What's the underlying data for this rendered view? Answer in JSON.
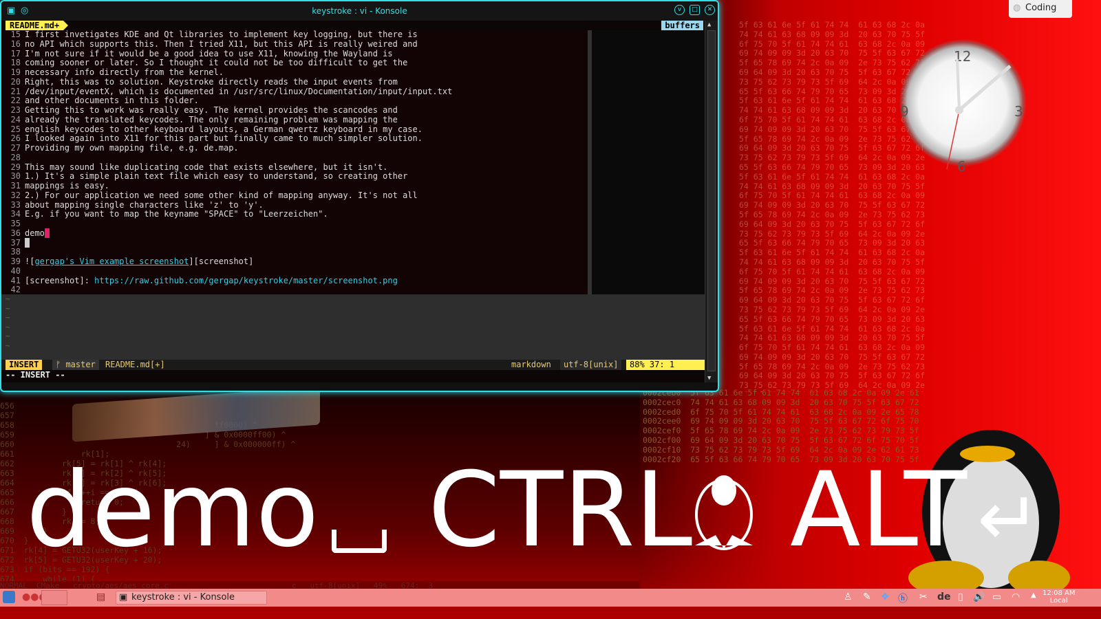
{
  "window": {
    "title": "keystroke : vi - Konsole"
  },
  "vim": {
    "tab": "README.md+",
    "buffers": "buffers",
    "lines": [
      {
        "n": "15",
        "t": "I first invetigates KDE and Qt libraries to implement key logging, but there is"
      },
      {
        "n": "16",
        "t": "no API which supports this. Then I tried X11, but this API is really weired and"
      },
      {
        "n": "17",
        "t": "I'm not sure if it would be a good idea to use X11, knowing the Wayland is"
      },
      {
        "n": "18",
        "t": "coming sooner or later. So I thought it could not be too difficult to get the"
      },
      {
        "n": "19",
        "t": "necessary info directly from the kernel."
      },
      {
        "n": "20",
        "t": "Right, this was to solution. Keystroke directly reads the input events from"
      },
      {
        "n": "21",
        "t": "/dev/input/eventX, which is documented in /usr/src/linux/Documentation/input/input.txt"
      },
      {
        "n": "22",
        "t": "and other documents in this folder."
      },
      {
        "n": "23",
        "t": "Getting this to work was really easy. The kernel provides the scancodes and"
      },
      {
        "n": "24",
        "t": "already the translated keycodes. The only remaining problem was mapping the"
      },
      {
        "n": "25",
        "t": "english keycodes to other keyboard layouts, a German qwertz keyboard in my case."
      },
      {
        "n": "26",
        "t": "I looked again into X11 for this part but finally came to much simpler solution."
      },
      {
        "n": "27",
        "t": "Providing my own mapping file, e.g. de.map."
      },
      {
        "n": "28",
        "t": ""
      },
      {
        "n": "29",
        "t": "This may sound like duplicating code that exists elsewhere, but it isn't."
      },
      {
        "n": "30",
        "t": "1.) It's a simple plain text file which easy to understand, so creating other"
      },
      {
        "n": "31",
        "t": "mappings is easy."
      },
      {
        "n": "32",
        "t": "2.) For our application we need some other kind of mapping anyway. It's not all"
      },
      {
        "n": "33",
        "t": "about mapping single characters like 'z' to 'y'."
      },
      {
        "n": "34",
        "t": "E.g. if you want to map the keyname \"SPACE\" to \"Leerzeichen\"."
      },
      {
        "n": "35",
        "t": ""
      },
      {
        "n": "36",
        "t": "demo"
      },
      {
        "n": "37",
        "t": ""
      },
      {
        "n": "38",
        "t": ""
      }
    ],
    "line39": {
      "n": "39",
      "pre": "![",
      "link": "gergap's Vim example screenshot",
      "post": "][screenshot]"
    },
    "line40": {
      "n": "40"
    },
    "line41": {
      "n": "41",
      "pre": "[screenshot]: ",
      "url": "https://raw.github.com/gergap/keystroke/master/screenshot.png"
    },
    "line42": {
      "n": "42"
    },
    "status": {
      "mode": "INSERT",
      "branch": "master",
      "file": "README.md[+]",
      "filetype": "markdown",
      "encoding": "utf-8[unix]",
      "percent": "88%",
      "position": "37:  1"
    },
    "cmdline": "-- INSERT --"
  },
  "background": {
    "code": [
      "656",
      "657",
      "658                                          ff0000) ^",
      "659                                        ] & 0x0000ff00) ^",
      "660                                  24)     ] & 0x000000ff) ^",
      "661              rk[1];",
      "662          rk[5] = rk[1] ^ rk[4];",
      "663          rk[6] = rk[2] ^ rk[5];",
      "664          rk[7] = rk[3] ^ rk[6];",
      "665          if (++i == 10) {",
      "666              return 0;",
      "667          }",
      "668          rk += 8;",
      "669      }",
      "670  }",
      "671  rk[4] = GETU32(userKey + 16);",
      "672  rk[5] = GETU32(userKey + 20);",
      "673  if (bits == 192) {",
      "674      while (1) {"
    ],
    "status": "NORMAL  CMake   crypto/aes/aes_core.c                           c   utf-8[unix]   49%   674:  3",
    "hex": [
      "0002ceb0  5f 63 61 6e 5f 61 74 74  61 63 68 2c 0a 09 2e 61",
      "0002cec0  74 74 61 63 68 09 09 3d  20 63 70 75 5f 63 67 72",
      "0002ced0  6f 75 70 5f 61 74 74 61  63 68 2c 0a 09 2e 65 78",
      "0002cee0  69 74 09 09 3d 20 63 70  75 5f 63 67 72 6f 75 70",
      "0002cef0  5f 65 78 69 74 2c 0a 09  2e 73 75 62 73 79 73 5f",
      "0002cf00  69 64 09 3d 20 63 70 75  5f 63 67 72 6f 75 70 5f",
      "0002cf10  73 75 62 73 79 73 5f 69  64 2c 0a 09 2e 62 61 73",
      "0002cf20  65 5f 63 66 74 79 70 65  73 09 3d 20 63 70 75 5f"
    ]
  },
  "overlay": {
    "keys": "demo",
    "ctrl": "CTRL",
    "alt": "ALT"
  },
  "clock": {
    "n12": "12",
    "n3": "3",
    "n6": "6",
    "n9": "9"
  },
  "activity": "Coding",
  "taskbar": {
    "task": "keystroke : vi - Konsole",
    "layout": "de",
    "time": "12:08 AM",
    "zone": "Local"
  },
  "colors": {
    "accent": "#2fe0e8",
    "insert": "#ffef50",
    "cursor": "#e0206a",
    "taskbar": "#f28a8a"
  }
}
